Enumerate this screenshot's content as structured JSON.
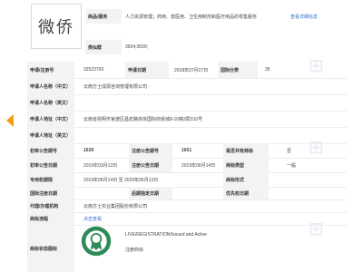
{
  "logo_text": "微侨",
  "goods": {
    "label": "商品/服务",
    "value": "人力资源管理；药用、兽医用、卫生用制剂和医疗用品的零售服务",
    "link": "查看详细信息"
  },
  "class_group": {
    "label": "类似群",
    "value": "3504;3509;"
  },
  "reg_no": {
    "label": "申请/注册号",
    "value": "32523793"
  },
  "apply_date": {
    "label": "申请日期",
    "value": "2018年07月27日"
  },
  "intl_class": {
    "label": "国际分类",
    "value": "35"
  },
  "applicant_cn": {
    "label": "申请人名称（中文）",
    "value": "云南方士成源咨询管理有限公司"
  },
  "applicant_en": {
    "label": "申请人名称（英文）",
    "value": ""
  },
  "address_cn": {
    "label": "申请人地址（中文）",
    "value": "云南省昆明市官渡区昌宏路体体国际商受城8-10幢3层310号"
  },
  "address_en": {
    "label": "申请人地址（英文）",
    "value": ""
  },
  "prelim_no": {
    "label": "初审公告期号",
    "value": "1639"
  },
  "reg_pub_no": {
    "label": "注册公告期号",
    "value": "1651"
  },
  "shared": {
    "label": "是否共有商标",
    "value": "否"
  },
  "prelim_date": {
    "label": "初审公告日期",
    "value": "2019年03月13日"
  },
  "reg_pub_date": {
    "label": "注册公告日期",
    "value": "2019年06月14日"
  },
  "mark_type": {
    "label": "商标类型",
    "value": "一般"
  },
  "exclusive": {
    "label": "专用权期限",
    "value": "2019年06月14日 至 2029年06月13日"
  },
  "mark_form": {
    "label": "商标形式",
    "value": ""
  },
  "intl_reg_date": {
    "label": "国际注册日期",
    "value": ""
  },
  "later_date": {
    "label": "后期指定日期",
    "value": ""
  },
  "priority_date": {
    "label": "优先权日期",
    "value": ""
  },
  "agent": {
    "label": "代理/办理机构",
    "value": "云南方士实业集团股份有限公司"
  },
  "process": {
    "label": "商标流程",
    "value": "点击查看"
  },
  "status": {
    "label": "商标状态图标",
    "line1": "LIVE/REGISTRATION/Issued and Active",
    "line2": "注册商标"
  },
  "colors": {
    "link": "#2f6fcf",
    "arrow": "#f39c12",
    "badge": "#2e8b57"
  },
  "icons": {
    "nav": "chevron-left-icon",
    "status": "registered-badge-icon"
  }
}
